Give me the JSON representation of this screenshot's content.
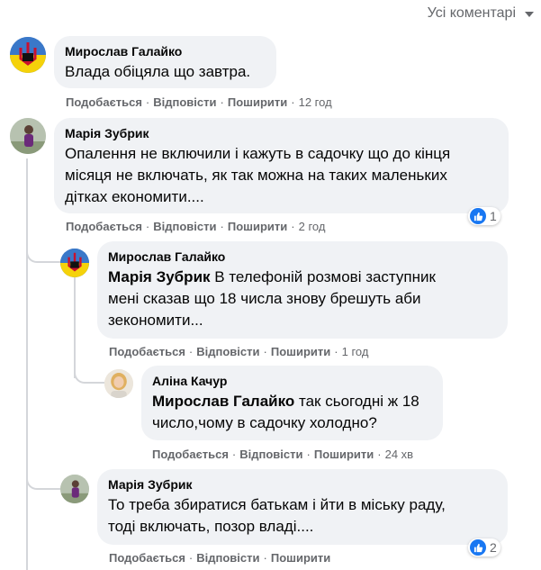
{
  "header": {
    "sort_label": "Усі коментарі"
  },
  "actions": {
    "like": "Подобається",
    "reply": "Відповісти",
    "share": "Поширити"
  },
  "comments": [
    {
      "author": "Мирослав Галайко",
      "lines": [
        "Влада обіцяла що завтра."
      ],
      "time": "12 год"
    },
    {
      "author": "Марія Зубрик",
      "lines": [
        "Опалення не включили і кажуть в садочку що до кінця",
        "місяця не включать, як так можна на таких маленьких",
        "дітках економити...."
      ],
      "time": "2 год",
      "reactions": "1"
    },
    {
      "author": "Мирослав Галайко",
      "mention": "Марія Зубрик",
      "lines": [
        " В телефоній розмові заступник",
        "мені сказав що 18 числа знову брешуть аби",
        "зекономити..."
      ],
      "time": "1 год"
    },
    {
      "author": "Аліна Качур",
      "mention": "Мирослав Галайко",
      "lines": [
        " так сьогодні ж 18",
        "число,чому в садочку холодно?"
      ],
      "time": "24 хв"
    },
    {
      "author": "Марія Зубрик",
      "lines": [
        "То треба збиратися батькам і йти в міську раду,",
        "тоді включать, позор владі...."
      ],
      "reactions": "2"
    }
  ]
}
